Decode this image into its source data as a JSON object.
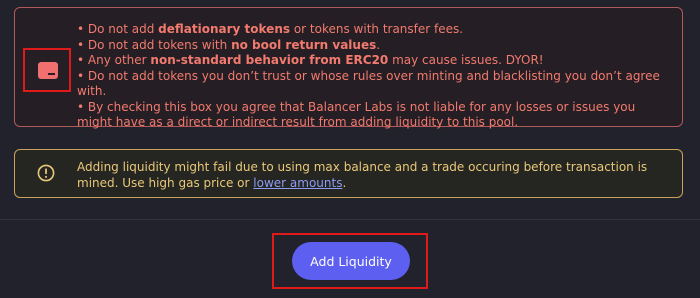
{
  "disclaimer": {
    "rules": [
      {
        "prefix": "• Do not add ",
        "bold": "deflationary tokens",
        "suffix": " or tokens with transfer fees."
      },
      {
        "prefix": "• Do not add tokens with ",
        "bold": "no bool return values",
        "suffix": "."
      },
      {
        "prefix": "• Any other ",
        "bold": "non-standard behavior from ERC20",
        "suffix": " may cause issues. DYOR!"
      },
      {
        "prefix": "• Do not add tokens you don’t trust or whose rules over minting and blacklisting you don’t agree with.",
        "bold": "",
        "suffix": ""
      },
      {
        "prefix": "• By checking this box you agree that Balancer Labs is not liable for any losses or issues you might have as a direct or indirect result from adding liquidity to this pool.",
        "bold": "",
        "suffix": ""
      }
    ],
    "checkbox_checked": true
  },
  "info": {
    "icon": "exclamation-circle-icon",
    "text_before": "Adding liquidity might fail due to using max balance and a trade occuring before transaction is mined. Use high gas price or ",
    "link": "lower amounts",
    "text_after": "."
  },
  "actions": {
    "add_liquidity_label": "Add Liquidity"
  },
  "colors": {
    "background": "#21222c",
    "danger_text": "#f27a6e",
    "warning_text": "#e9c979",
    "link": "#8b9cf5",
    "primary_button": "#5c5ff0"
  }
}
